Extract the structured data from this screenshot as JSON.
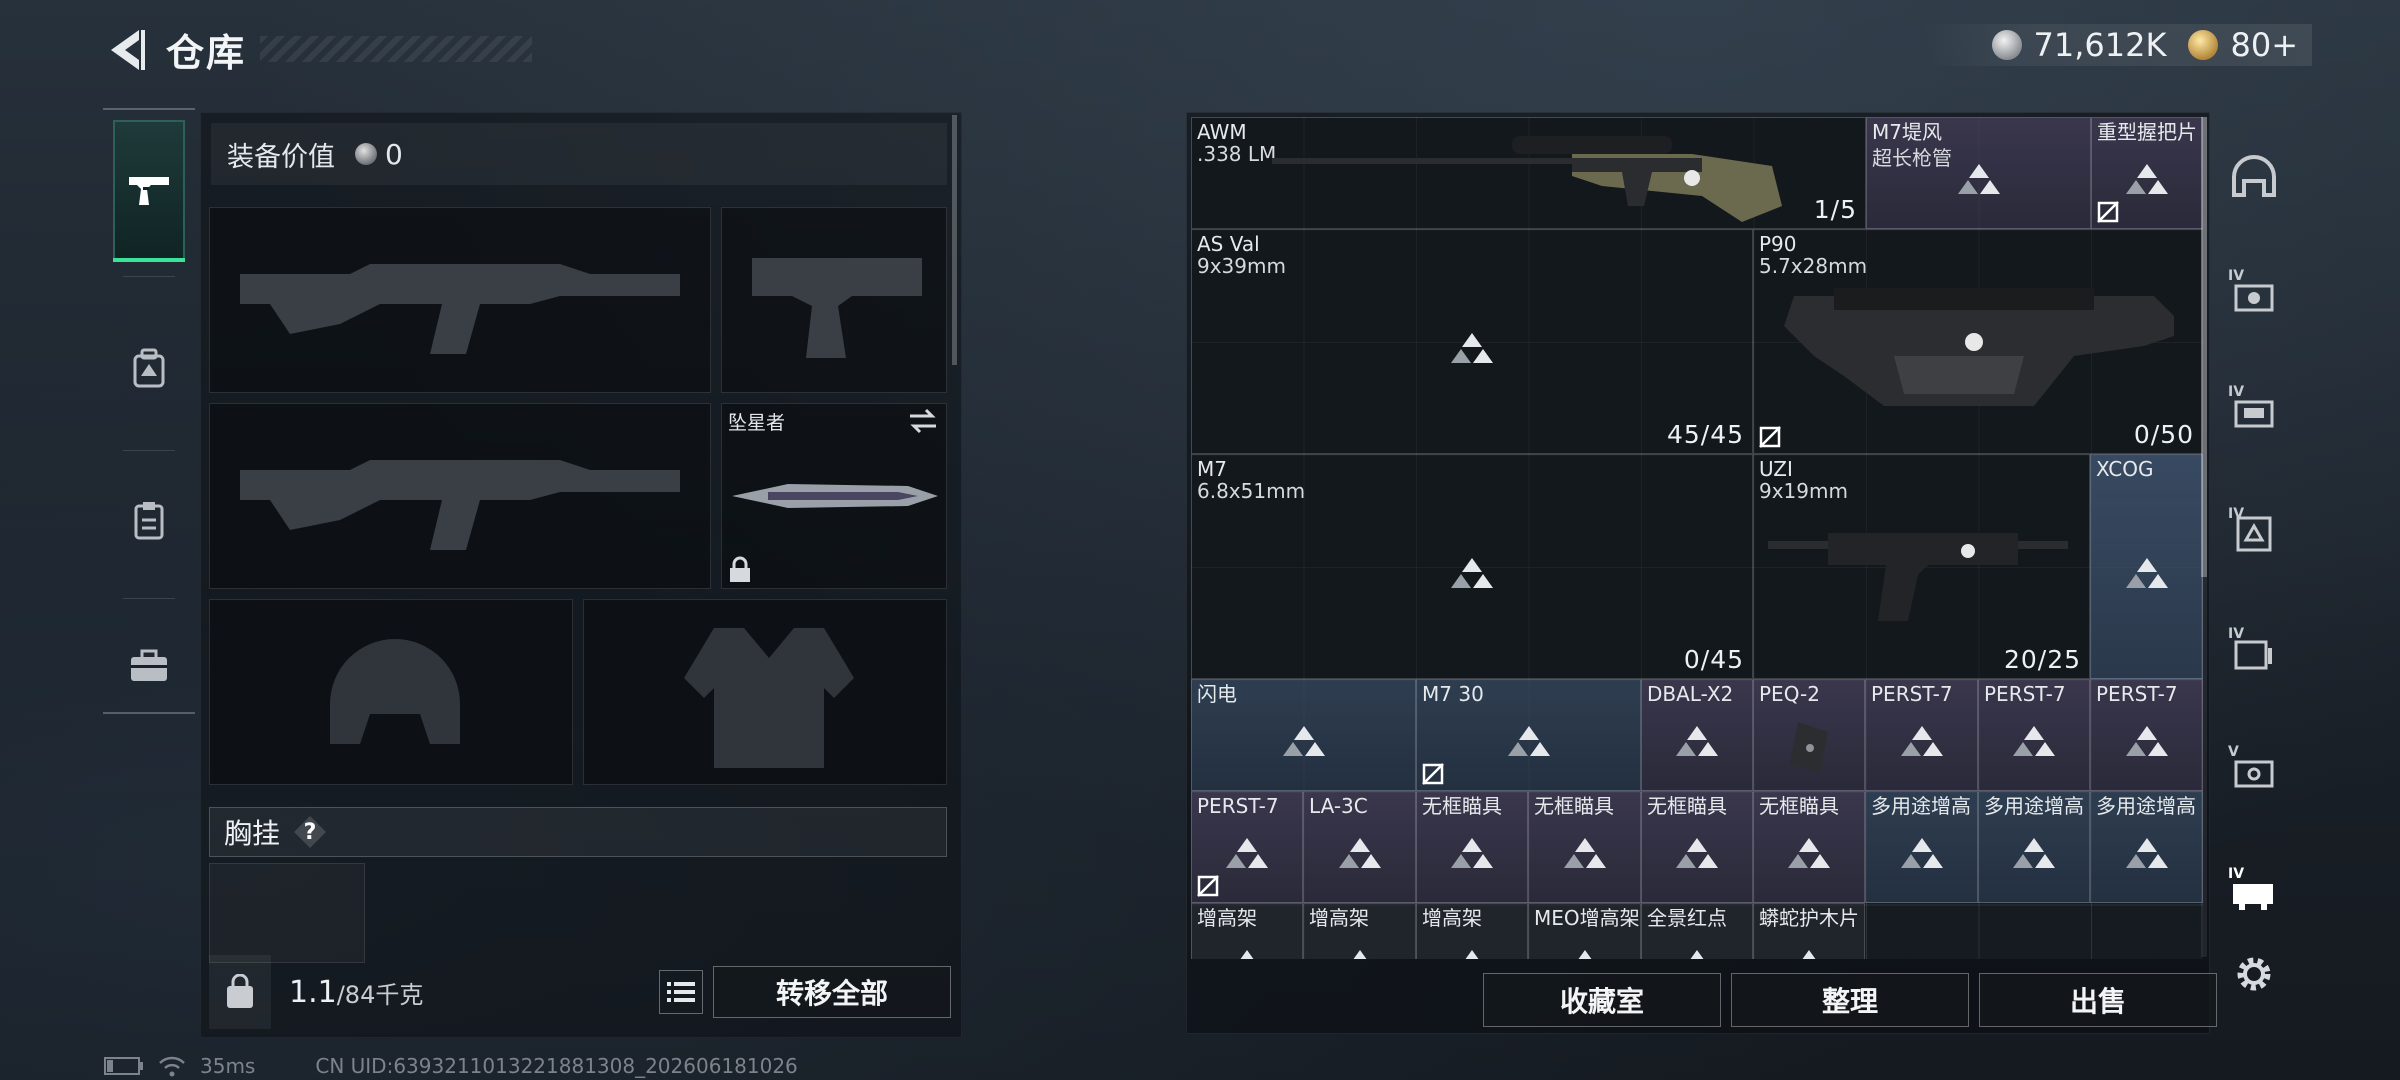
{
  "header": {
    "title": "仓库",
    "back_icon": "back-arrow-icon"
  },
  "currency": {
    "silver": "71,612K",
    "gold": "80+"
  },
  "left_rail": {
    "items": [
      {
        "name": "weapons",
        "icon": "pistol-icon",
        "active": true
      },
      {
        "name": "armor",
        "icon": "backpack-icon",
        "active": false
      },
      {
        "name": "supplies",
        "icon": "clipboard-icon",
        "active": false
      },
      {
        "name": "gear",
        "icon": "toolbox-icon",
        "active": false
      }
    ]
  },
  "loadout": {
    "value_label": "装备价值",
    "value": "0",
    "melee_label": "坠星者",
    "chest_rig_label": "胸挂",
    "chest_rig_help": "?",
    "weight_current": "1.1",
    "weight_max": "/84千克",
    "transfer_all": "转移全部"
  },
  "storage": {
    "items": [
      {
        "name": "AWM",
        "sub": ".338 LM",
        "count": "1/5"
      },
      {
        "name": "M7堤风",
        "sub": "超长枪管"
      },
      {
        "name": "重型握把片"
      },
      {
        "name": "AS Val",
        "sub": "9x39mm",
        "count": "45/45"
      },
      {
        "name": "P90",
        "sub": "5.7x28mm",
        "count": "0/50"
      },
      {
        "name": "M7",
        "sub": "6.8x51mm",
        "count": "0/45"
      },
      {
        "name": "UZI",
        "sub": "9x19mm",
        "count": "20/25"
      },
      {
        "name": "XCOG"
      },
      {
        "name": "闪电"
      },
      {
        "name": "M7 30"
      },
      {
        "name": "DBAL-X2"
      },
      {
        "name": "PEQ-2"
      },
      {
        "name": "PERST-7"
      },
      {
        "name": "PERST-7"
      },
      {
        "name": "PERST-7"
      },
      {
        "name": "PERST-7"
      },
      {
        "name": "LA-3C"
      },
      {
        "name": "无框瞄具"
      },
      {
        "name": "无框瞄具"
      },
      {
        "name": "无框瞄具"
      },
      {
        "name": "无框瞄具"
      },
      {
        "name": "多用途增高"
      },
      {
        "name": "多用途增高"
      },
      {
        "name": "多用途增高"
      },
      {
        "name": "增高架"
      },
      {
        "name": "增高架"
      },
      {
        "name": "增高架"
      },
      {
        "name": "MEO增高架"
      },
      {
        "name": "全景红点"
      },
      {
        "name": "蟒蛇护木片"
      }
    ],
    "buttons": {
      "collection": "收藏室",
      "sort": "整理",
      "sell": "出售"
    }
  },
  "right_rail": {
    "items": [
      {
        "tag": "",
        "icon": "helmet-icon"
      },
      {
        "tag": "IV",
        "icon": "armor-filter-icon"
      },
      {
        "tag": "IV",
        "icon": "vest-filter-icon"
      },
      {
        "tag": "IV",
        "icon": "backpack-filter-icon"
      },
      {
        "tag": "IV",
        "icon": "container-filter-icon"
      },
      {
        "tag": "V",
        "icon": "case-filter-icon"
      },
      {
        "tag": "IV",
        "icon": "crate-filter-icon",
        "selected": true
      }
    ],
    "settings_icon": "gear-icon"
  },
  "status": {
    "ping": "35ms",
    "uid": "CN UID:6393211013221881308_202606181026"
  }
}
